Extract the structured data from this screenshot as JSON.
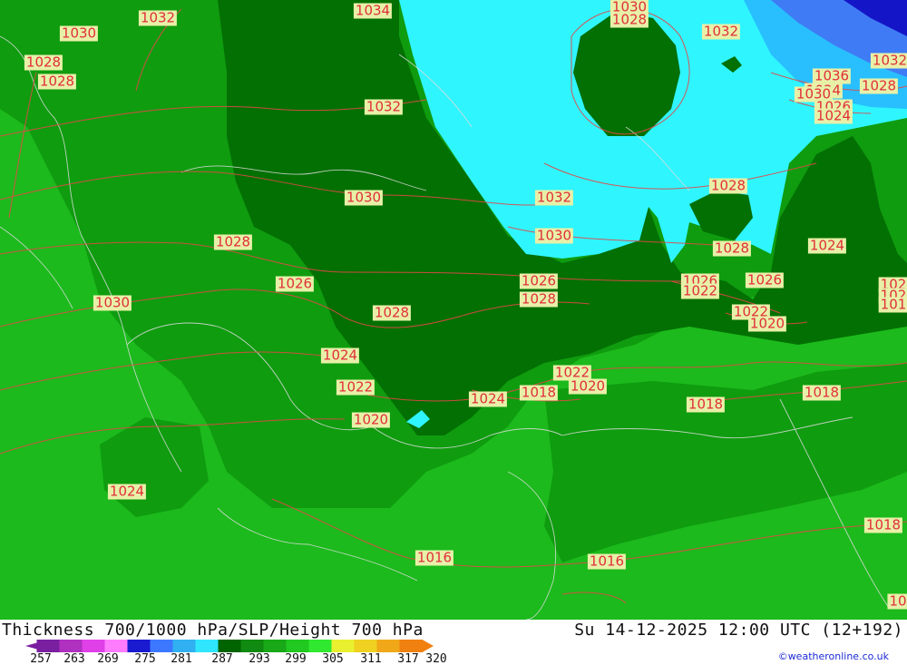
{
  "map": {
    "pressure_labels": [
      {
        "text": "1034",
        "name": "isobar-1034"
      },
      {
        "text": "1032",
        "name": "isobar-1032-nw"
      },
      {
        "text": "1030",
        "name": "isobar-1030-nw"
      },
      {
        "text": "1028",
        "name": "isobar-1028-nw-a"
      },
      {
        "text": "1028",
        "name": "isobar-1028-nw-b"
      },
      {
        "text": "1030",
        "name": "isobar-1030-n"
      },
      {
        "text": "1028",
        "name": "isobar-1028-n"
      },
      {
        "text": "1032",
        "name": "isobar-1032-ne"
      },
      {
        "text": "1032",
        "name": "isobar-1032-far-ne"
      },
      {
        "text": "1036",
        "name": "isobar-1036"
      },
      {
        "text": "1034",
        "name": "isobar-1034-ne"
      },
      {
        "text": "1030",
        "name": "isobar-1030-ne"
      },
      {
        "text": "1028",
        "name": "isobar-1028-ne"
      },
      {
        "text": "1026",
        "name": "isobar-1026-ne"
      },
      {
        "text": "1024",
        "name": "isobar-1024-ne"
      },
      {
        "text": "1032",
        "name": "isobar-1032-c"
      },
      {
        "text": "1030",
        "name": "isobar-1030-c"
      },
      {
        "text": "1032",
        "name": "isobar-1032-e"
      },
      {
        "text": "1030",
        "name": "isobar-1030-e"
      },
      {
        "text": "1028",
        "name": "isobar-1028-c"
      },
      {
        "text": "1026",
        "name": "isobar-1026-c"
      },
      {
        "text": "1028",
        "name": "isobar-1028-e"
      },
      {
        "text": "1026",
        "name": "isobar-1026-e"
      },
      {
        "text": "1022",
        "name": "isobar-1022-e"
      },
      {
        "text": "1028",
        "name": "isobar-1028-e2"
      },
      {
        "text": "1026",
        "name": "isobar-1026-e2"
      },
      {
        "text": "1024",
        "name": "isobar-1024-e"
      },
      {
        "text": "1022",
        "name": "isobar-1022-e2"
      },
      {
        "text": "1020",
        "name": "isobar-1020-e"
      },
      {
        "text": "102",
        "name": "isobar-edge-a"
      },
      {
        "text": "102",
        "name": "isobar-edge-b"
      },
      {
        "text": "101",
        "name": "isobar-edge-c"
      },
      {
        "text": "1028",
        "name": "isobar-1028-w"
      },
      {
        "text": "1026",
        "name": "isobar-1026-w"
      },
      {
        "text": "1030",
        "name": "isobar-1030-w"
      },
      {
        "text": "1028",
        "name": "isobar-1028-sc"
      },
      {
        "text": "1024",
        "name": "isobar-1024-w"
      },
      {
        "text": "1022",
        "name": "isobar-1022-w"
      },
      {
        "text": "1020",
        "name": "isobar-1020-w"
      },
      {
        "text": "1024",
        "name": "isobar-1024-sc"
      },
      {
        "text": "1018",
        "name": "isobar-1018-sc"
      },
      {
        "text": "1022",
        "name": "isobar-1022-sc"
      },
      {
        "text": "1020",
        "name": "isobar-1020-sc"
      },
      {
        "text": "1018",
        "name": "isobar-1018-se"
      },
      {
        "text": "1018",
        "name": "isobar-1018-e"
      },
      {
        "text": "1024",
        "name": "isobar-1024-sw"
      },
      {
        "text": "1016",
        "name": "isobar-1016-s"
      },
      {
        "text": "1016",
        "name": "isobar-1016-s2"
      },
      {
        "text": "1018",
        "name": "isobar-1018-far-e"
      },
      {
        "text": "10",
        "name": "isobar-edge-d"
      }
    ]
  },
  "footer": {
    "title": "Thickness 700/1000 hPa/SLP/Height 700 hPa",
    "datetime": "Su 14-12-2025 12:00 UTC (12+192)",
    "credit": "©weatheronline.co.uk"
  },
  "legend": {
    "ticks": [
      "257",
      "263",
      "269",
      "275",
      "281",
      "287",
      "293",
      "299",
      "305",
      "311",
      "317",
      "320"
    ],
    "colors": [
      "#7a1fa0",
      "#b030c0",
      "#e040e8",
      "#ff7cff",
      "#1a1ad0",
      "#3c78ff",
      "#30b0f0",
      "#30e6ff",
      "#006400",
      "#108a10",
      "#18a818",
      "#20c820",
      "#30e830",
      "#e8f030",
      "#f0d020",
      "#f0a818",
      "#f08010"
    ]
  }
}
